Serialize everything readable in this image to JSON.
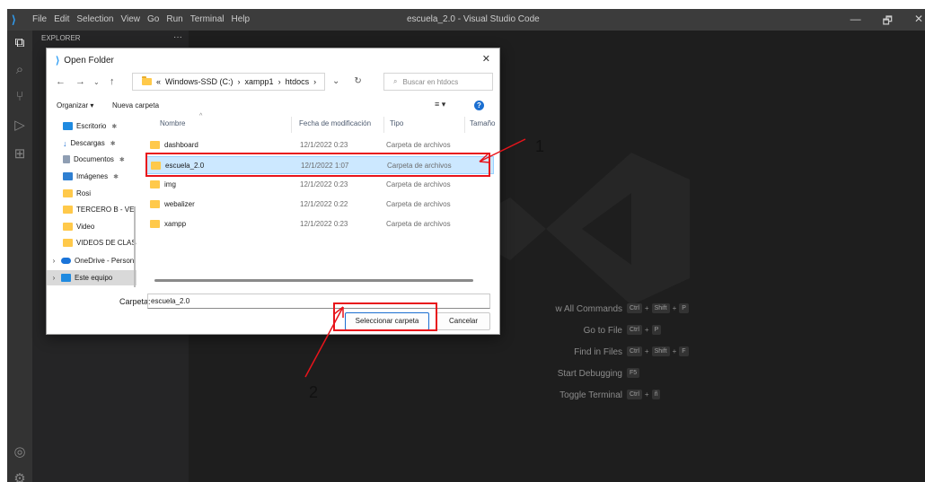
{
  "app": {
    "menu": [
      "File",
      "Edit",
      "Selection",
      "View",
      "Go",
      "Run",
      "Terminal",
      "Help"
    ],
    "window_title": "escuela_2.0 - Visual Studio Code",
    "window_controls": [
      "—",
      "🗗",
      "✕"
    ]
  },
  "sidebar": {
    "title": "EXPLORER",
    "more": "···"
  },
  "activity_icons": [
    "explorer-icon",
    "search-icon",
    "source-control-icon",
    "run-debug-icon",
    "extensions-icon",
    "account-icon",
    "settings-gear-icon"
  ],
  "welcome_shortcuts": [
    {
      "label": "w All Commands",
      "keys": [
        "Ctrl",
        "Shift",
        "P"
      ]
    },
    {
      "label": "Go to File",
      "keys": [
        "Ctrl",
        "P"
      ]
    },
    {
      "label": "Find in Files",
      "keys": [
        "Ctrl",
        "Shift",
        "F"
      ]
    },
    {
      "label": "Start Debugging",
      "keys": [
        "F5"
      ]
    },
    {
      "label": "Toggle Terminal",
      "keys": [
        "Ctrl",
        "ñ"
      ]
    }
  ],
  "dialog": {
    "title": "Open Folder",
    "close": "✕",
    "breadcrumb": [
      "«",
      "Windows-SSD (C:)",
      "›",
      "xampp1",
      "›",
      "htdocs",
      "›"
    ],
    "search_placeholder": "Buscar en htdocs",
    "toolbar": {
      "organize": "Organizar ▾",
      "new_folder": "Nueva carpeta",
      "view": "≡ ▾",
      "help": "?"
    },
    "nav_items": [
      {
        "label": "Escritorio",
        "icon": "desktop",
        "pinned": true
      },
      {
        "label": "Descargas",
        "icon": "download",
        "pinned": true
      },
      {
        "label": "Documentos",
        "icon": "document",
        "pinned": true
      },
      {
        "label": "Imágenes",
        "icon": "image",
        "pinned": true
      },
      {
        "label": "Rosi",
        "icon": "folder",
        "pinned": false
      },
      {
        "label": "TERCERO B - VE",
        "icon": "folder",
        "pinned": false
      },
      {
        "label": "Video",
        "icon": "folder",
        "pinned": false
      },
      {
        "label": "VIDEOS DE CLAS",
        "icon": "folder",
        "pinned": false
      },
      {
        "label": "OneDrive - Person",
        "icon": "cloud",
        "pinned": false
      },
      {
        "label": "Este equipo",
        "icon": "pc",
        "pinned": false
      }
    ],
    "columns": [
      "Nombre",
      "Fecha de modificación",
      "Tipo",
      "Tamaño"
    ],
    "rows": [
      {
        "name": "dashboard",
        "date": "12/1/2022 0:23",
        "type": "Carpeta de archivos"
      },
      {
        "name": "escuela_2.0",
        "date": "12/1/2022 1:07",
        "type": "Carpeta de archivos",
        "selected": true
      },
      {
        "name": "img",
        "date": "12/1/2022 0:23",
        "type": "Carpeta de archivos"
      },
      {
        "name": "webalizer",
        "date": "12/1/2022 0:22",
        "type": "Carpeta de archivos"
      },
      {
        "name": "xampp",
        "date": "12/1/2022 0:23",
        "type": "Carpeta de archivos"
      }
    ],
    "folder_label": "Carpeta:",
    "folder_value": "escuela_2.0",
    "select_button": "Seleccionar carpeta",
    "cancel_button": "Cancelar"
  },
  "annotations": {
    "step1": "1",
    "step2": "2",
    "color": "#e8141b"
  }
}
